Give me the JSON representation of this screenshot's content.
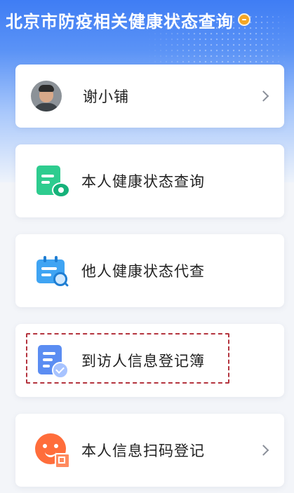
{
  "header": {
    "title": "北京市防疫相关健康状态查询"
  },
  "user": {
    "name": "谢小铺"
  },
  "menu": {
    "self_query": "本人健康状态查询",
    "proxy_query": "他人健康状态代查",
    "visitor_register": "到访人信息登记簿",
    "scan_register": "本人信息扫码登记"
  },
  "colors": {
    "header_blue": "#3f7df4",
    "self_query_icon": "#2ecc8f",
    "proxy_query_icon": "#3fa4f3",
    "visitor_register_icon": "#5b8df2",
    "scan_register_icon": "#ff6d3b",
    "highlight_border": "#b4343e",
    "info_dot": "#f5a623"
  },
  "icons": {
    "info": "info-icon",
    "self_query": "health-document-icon",
    "proxy_query": "calendar-search-icon",
    "visitor_register": "register-book-icon",
    "scan_register": "scan-code-icon",
    "chevron": "chevron-right-icon"
  }
}
